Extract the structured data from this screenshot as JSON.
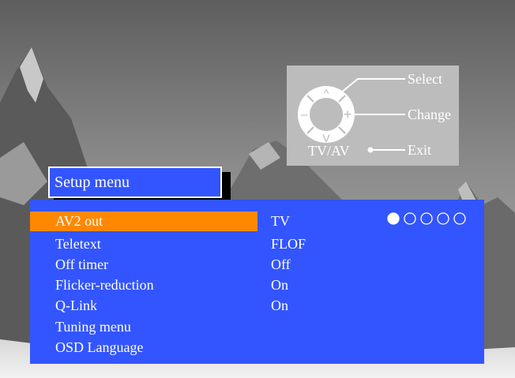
{
  "remote_hint": {
    "select_label": "Select",
    "change_label": "Change",
    "exit_label": "Exit",
    "tvav_label": "TV/AV",
    "up_glyph": "^",
    "down_glyph": "V",
    "minus_glyph": "–",
    "plus_glyph": "+"
  },
  "title": "Setup menu",
  "menu": {
    "items": [
      {
        "label": "AV2 out",
        "value": "TV",
        "selected": true
      },
      {
        "label": "Teletext",
        "value": "FLOF"
      },
      {
        "label": "Off timer",
        "value": "Off"
      },
      {
        "label": "Flicker-reduction",
        "value": "On"
      },
      {
        "label": "Q-Link",
        "value": "On"
      },
      {
        "label": "Tuning menu",
        "value": ""
      },
      {
        "label": "OSD Language",
        "value": ""
      }
    ],
    "option_dots": {
      "total": 5,
      "filled_index": 0
    }
  },
  "colors": {
    "menu_blue": "#3355ff",
    "highlight_orange": "#ff8800",
    "hint_panel_grey": "#bcbcbc",
    "text_white": "#ffffff"
  }
}
